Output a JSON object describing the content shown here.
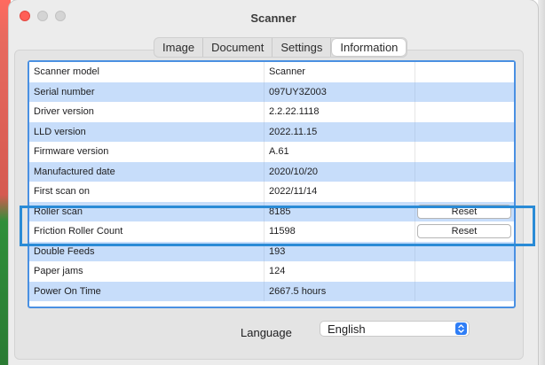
{
  "window": {
    "title": "Scanner"
  },
  "tabs": [
    {
      "label": "Image"
    },
    {
      "label": "Document"
    },
    {
      "label": "Settings"
    },
    {
      "label": "Information"
    }
  ],
  "active_tab": "Information",
  "info_rows": [
    {
      "label": "Scanner model",
      "value": "Scanner",
      "action": ""
    },
    {
      "label": "Serial number",
      "value": "097UY3Z003",
      "action": ""
    },
    {
      "label": "Driver version",
      "value": "2.2.22.1118",
      "action": ""
    },
    {
      "label": "LLD version",
      "value": "2022.11.15",
      "action": ""
    },
    {
      "label": "Firmware version",
      "value": "A.61",
      "action": ""
    },
    {
      "label": "Manufactured date",
      "value": "2020/10/20",
      "action": ""
    },
    {
      "label": "First scan on",
      "value": "2022/11/14",
      "action": ""
    },
    {
      "label": "Roller scan",
      "value": "8185",
      "action": "Reset"
    },
    {
      "label": "Friction Roller Count",
      "value": "11598",
      "action": "Reset"
    },
    {
      "label": "Double Feeds",
      "value": "193",
      "action": ""
    },
    {
      "label": "Paper jams",
      "value": "124",
      "action": ""
    },
    {
      "label": "Power On Time",
      "value": "2667.5 hours",
      "action": ""
    }
  ],
  "language": {
    "label": "Language",
    "selected": "English"
  },
  "colors": {
    "accent": "#2a8bd6",
    "row_alt": "#c7ddfa",
    "table_border": "#4a90e2"
  }
}
